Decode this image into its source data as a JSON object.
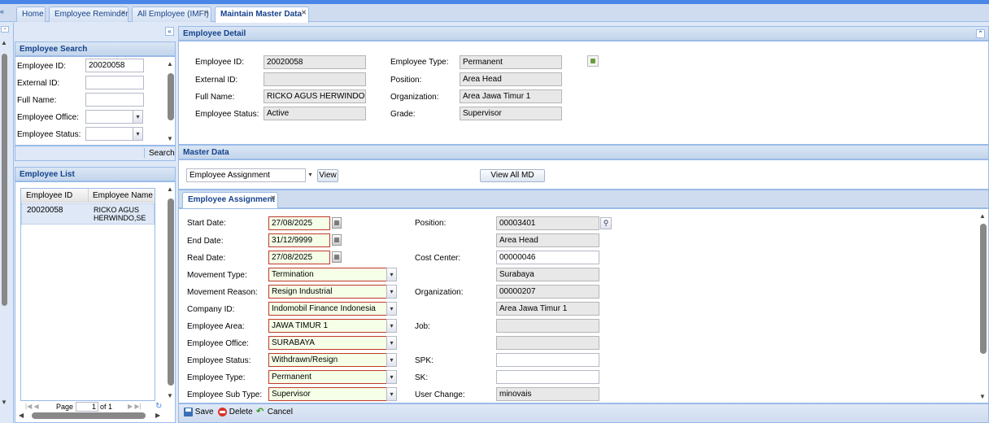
{
  "tabs": [
    {
      "label": "Home",
      "closable": false
    },
    {
      "label": "Employee Reminder",
      "closable": true
    },
    {
      "label": "All Employee (IMFI)",
      "closable": true
    },
    {
      "label": "Maintain Master Data",
      "closable": true,
      "active": true
    }
  ],
  "search": {
    "title": "Employee Search",
    "employee_id_label": "Employee ID:",
    "employee_id_value": "20020058",
    "external_id_label": "External ID:",
    "full_name_label": "Full Name:",
    "office_label": "Employee Office:",
    "status_label": "Employee Status:",
    "search_button": "Search"
  },
  "list": {
    "title": "Employee List",
    "col_id": "Employee ID",
    "col_name": "Employee Name",
    "rows": [
      {
        "id": "20020058",
        "name": "RICKO AGUS HERWINDO,SE"
      }
    ],
    "pager_page": "Page",
    "pager_value": "1",
    "pager_of": "of 1"
  },
  "detail": {
    "title": "Employee Detail",
    "employee_id_label": "Employee ID:",
    "employee_id": "20020058",
    "external_id_label": "External ID:",
    "external_id": "",
    "full_name_label": "Full Name:",
    "full_name": "RICKO AGUS HERWINDO,SE",
    "status_label": "Employee Status:",
    "status": "Active",
    "type_label": "Employee Type:",
    "type": "Permanent",
    "position_label": "Position:",
    "position": "Area Head",
    "organization_label": "Organization:",
    "organization": "Area Jawa Timur 1",
    "grade_label": "Grade:",
    "grade": "Supervisor"
  },
  "master": {
    "title": "Master Data",
    "select_value": "Employee Assignment",
    "view_button": "View",
    "view_all_button": "View All MD"
  },
  "assignment": {
    "tab_label": "Employee Assignment",
    "start_date_label": "Start Date:",
    "start_date": "27/08/2025",
    "end_date_label": "End Date:",
    "end_date": "31/12/9999",
    "real_date_label": "Real Date:",
    "real_date": "27/08/2025",
    "movement_type_label": "Movement Type:",
    "movement_type": "Termination",
    "movement_reason_label": "Movement Reason:",
    "movement_reason": "Resign Industrial",
    "company_label": "Company ID:",
    "company": "Indomobil Finance Indonesia",
    "area_label": "Employee Area:",
    "area": "JAWA TIMUR 1",
    "office_label": "Employee Office:",
    "office": "SURABAYA",
    "status_label": "Employee Status:",
    "status": "Withdrawn/Resign",
    "type_label": "Employee Type:",
    "type": "Permanent",
    "subtype_label": "Employee Sub Type:",
    "subtype": "Supervisor",
    "position_label": "Position:",
    "position_code": "00003401",
    "position_name": "Area Head",
    "cost_center_label": "Cost Center:",
    "cost_center_code": "00000046",
    "cost_center_name": "Surabaya",
    "organization_label": "Organization:",
    "organization_code": "00000207",
    "organization_name": "Area Jawa Timur 1",
    "job_label": "Job:",
    "spk_label": "SPK:",
    "sk_label": "SK:",
    "user_change_label": "User Change:",
    "user_change": "minovais"
  },
  "toolbar": {
    "save": "Save",
    "delete": "Delete",
    "cancel": "Cancel"
  }
}
